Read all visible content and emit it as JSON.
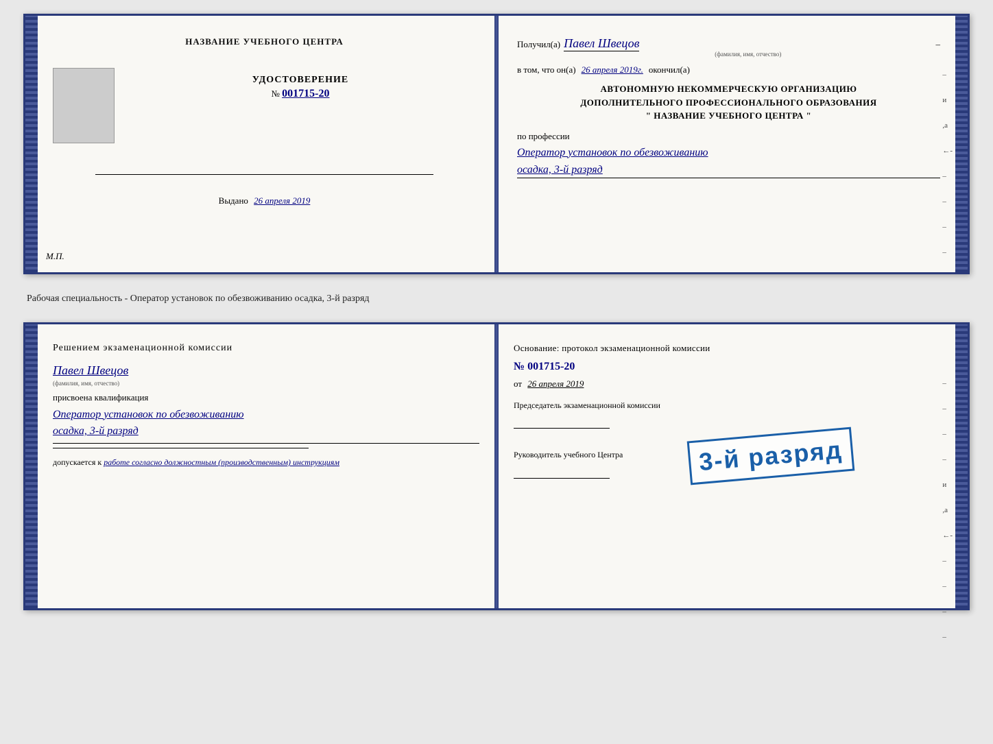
{
  "page": {
    "background": "#e8e8e8"
  },
  "certificate1": {
    "left": {
      "org_name": "НАЗВАНИЕ УЧЕБНОГО ЦЕНТРА",
      "udostoverenie_label": "УДОСТОВЕРЕНИЕ",
      "number_prefix": "№",
      "number": "001715-20",
      "vydano_label": "Выдано",
      "vydano_date": "26 апреля 2019",
      "mp_label": "М.П."
    },
    "right": {
      "poluchil_label": "Получил(а)",
      "poluchil_name": "Павел Швецов",
      "fio_label": "(фамилия, имя, отчество)",
      "dash": "–",
      "vtom_label": "в том, что он(а)",
      "vtom_date": "26 апреля 2019г.",
      "okonchil_label": "окончил(а)",
      "org_line1": "АВТОНОМНУЮ НЕКОММЕРЧЕСКУЮ ОРГАНИЗАЦИЮ",
      "org_line2": "ДОПОЛНИТЕЛЬНОГО ПРОФЕССИОНАЛЬНОГО ОБРАЗОВАНИЯ",
      "org_quote": "\"   НАЗВАНИЕ УЧЕБНОГО ЦЕНТРА   \"",
      "po_professii_label": "по профессии",
      "profession": "Оператор установок по обезвоживанию",
      "razryad": "осадка, 3-й разряд"
    }
  },
  "separator_text": "Рабочая специальность - Оператор установок по обезвоживанию осадка, 3-й разряд",
  "certificate2": {
    "left": {
      "resheniem_label": "Решением экзаменационной комиссии",
      "person_name": "Павел Швецов",
      "fio_label": "(фамилия, имя, отчество)",
      "prisvoeena_label": "присвоена квалификация",
      "profession": "Оператор установок по обезвоживанию",
      "razryad": "осадка, 3-й разряд",
      "dopuskaetsya_label": "допускается к",
      "dopuskaetsya_value": "работе согласно должностным (производственным) инструкциям"
    },
    "right": {
      "osnovaniye_label": "Основание: протокол экзаменационной комиссии",
      "number_prefix": "№",
      "number": "001715-20",
      "ot_label": "от",
      "ot_date": "26 апреля 2019",
      "predsedatel_label": "Председатель экзаменационной комиссии",
      "rukovoditel_label": "Руководитель учебного Центра"
    },
    "stamp": {
      "text": "3-й разряд"
    }
  }
}
